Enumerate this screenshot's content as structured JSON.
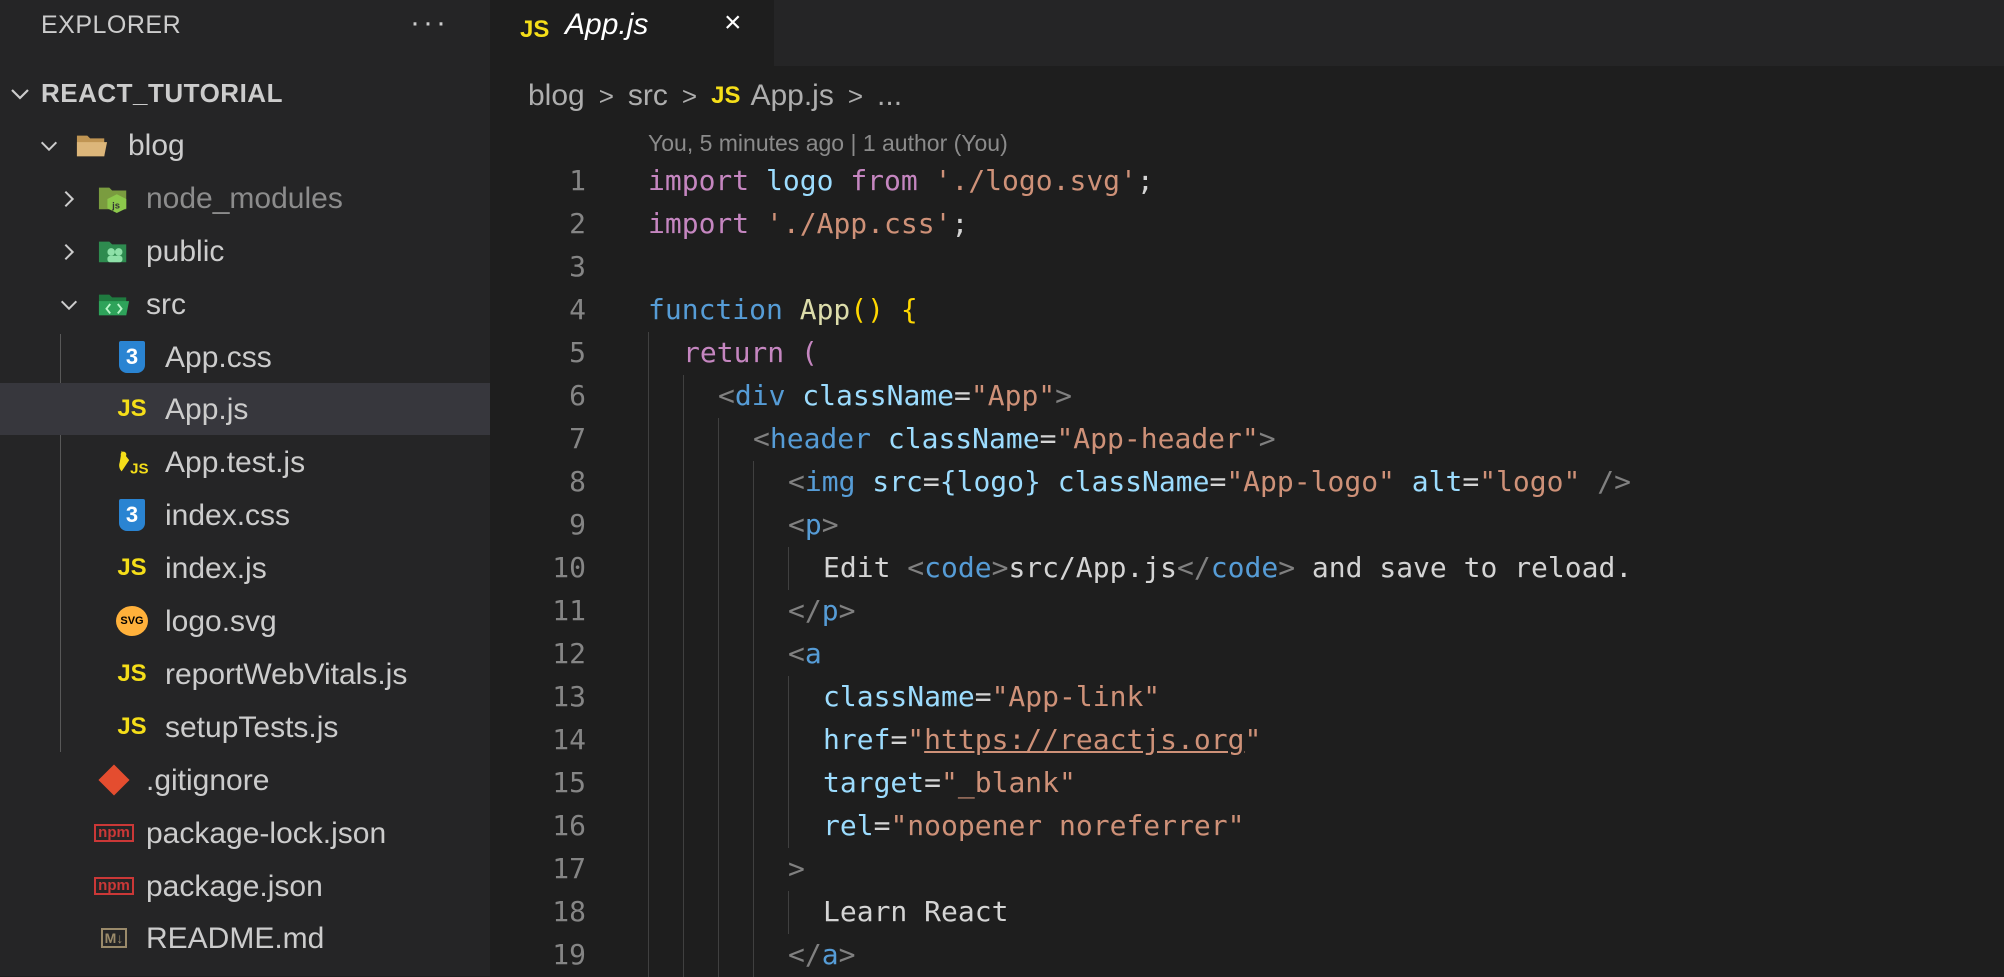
{
  "explorer": {
    "title": "EXPLORER",
    "more": "···",
    "root": "REACT_TUTORIAL",
    "items": [
      {
        "label": "blog"
      },
      {
        "label": "node_modules"
      },
      {
        "label": "public"
      },
      {
        "label": "src"
      },
      {
        "label": "App.css"
      },
      {
        "label": "App.js"
      },
      {
        "label": "App.test.js"
      },
      {
        "label": "index.css"
      },
      {
        "label": "index.js"
      },
      {
        "label": "logo.svg"
      },
      {
        "label": "reportWebVitals.js"
      },
      {
        "label": "setupTests.js"
      },
      {
        "label": ".gitignore"
      },
      {
        "label": "package-lock.json"
      },
      {
        "label": "package.json"
      },
      {
        "label": "README.md"
      }
    ]
  },
  "icons": {
    "js_text": "JS",
    "css_text": "3",
    "svg_text": "SVG",
    "npm_text": "npm",
    "md_text": "M↓"
  },
  "tab": {
    "label": "App.js",
    "close": "×"
  },
  "breadcrumb": {
    "parts": [
      "blog",
      "src",
      "App.js",
      "..."
    ],
    "sep": ">"
  },
  "blame": "You, 5 minutes ago | 1 author (You)",
  "code": {
    "line_numbers": [
      "1",
      "2",
      "3",
      "4",
      "5",
      "6",
      "7",
      "8",
      "9",
      "10",
      "11",
      "12",
      "13",
      "14",
      "15",
      "16",
      "17",
      "18",
      "19"
    ],
    "t": {
      "import": "import",
      "logo": "logo",
      "from": "from",
      "logo_path": "'./logo.svg'",
      "semi": ";",
      "css_path": "'./App.css'",
      "function": "function",
      "App": "App",
      "parens": "()",
      "brace_open": "{",
      "return": "return",
      "paren_open": "(",
      "lt": "<",
      "gt": ">",
      "lt_slash": "</",
      "self_close": "/>",
      "eq": "=",
      "div": "div",
      "header": "header",
      "img": "img",
      "p": "p",
      "a": "a",
      "code": "code",
      "className": "className",
      "src": "src",
      "alt": "alt",
      "href": "href",
      "target": "target",
      "rel": "rel",
      "q": "\"",
      "s_app": "\"App\"",
      "s_app_header": "\"App-header\"",
      "s_app_logo": "\"App-logo\"",
      "s_logo": "\"logo\"",
      "s_app_link": "\"App-link\"",
      "s_blank": "\"_blank\"",
      "s_rel": "\"noopener noreferrer\"",
      "url": "https://reactjs.org",
      "logo_expr": "{logo}",
      "edit": "Edit ",
      "src_path": "src/App.js",
      "save_text": " and save to reload.",
      "learn": "Learn React"
    }
  }
}
